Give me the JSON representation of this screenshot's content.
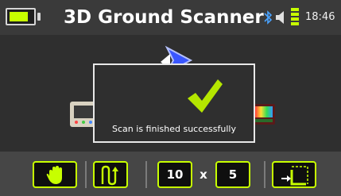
{
  "header": {
    "title": "3D Ground Scanner",
    "time": "18:46",
    "icons": [
      "battery-icon",
      "bluetooth-icon",
      "speaker-icon",
      "signal-icon"
    ],
    "battery_level": 0.75
  },
  "dialog": {
    "message": "Scan is finished successfully",
    "icon": "checkmark-icon"
  },
  "toolbar": {
    "grid_x": "10",
    "grid_separator": "x",
    "grid_y": "5",
    "icons": [
      "hand-icon",
      "zigzag-path-icon",
      "start-position-icon"
    ]
  },
  "colors": {
    "accent": "#c7ff00",
    "background": "#2f2f2f",
    "toolbar_bg": "#464646"
  }
}
